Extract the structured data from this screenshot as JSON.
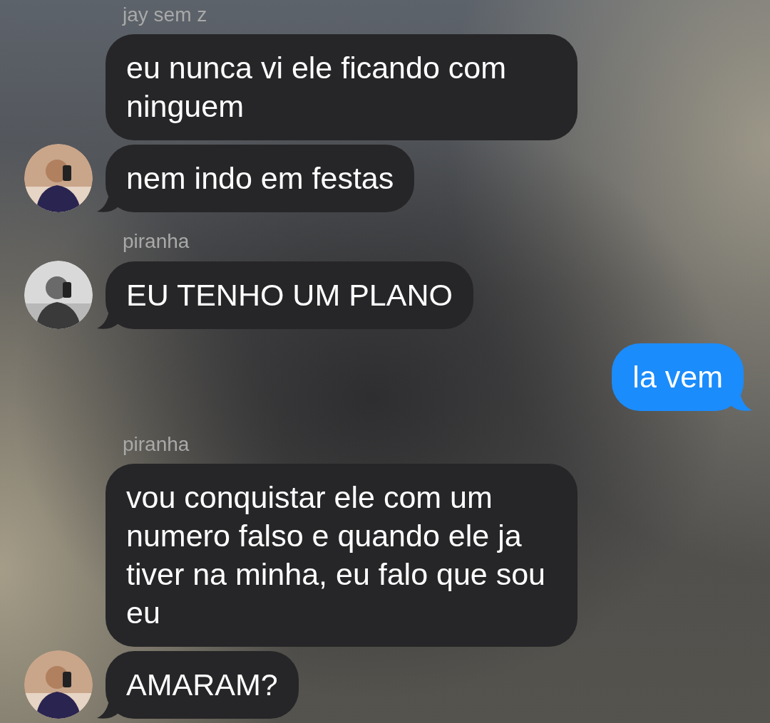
{
  "groups": [
    {
      "kind": "incoming",
      "sender": "jay sem z",
      "avatar": {
        "kind": "picture"
      },
      "messages": [
        "eu nunca vi ele ficando com ninguem",
        "nem indo em festas"
      ]
    },
    {
      "kind": "incoming",
      "sender": "piranha",
      "avatar": {
        "kind": "picture"
      },
      "messages": [
        "EU TENHO UM PLANO"
      ]
    },
    {
      "kind": "outgoing",
      "messages": [
        "la vem"
      ]
    },
    {
      "kind": "incoming",
      "sender": "piranha",
      "avatar": {
        "kind": "picture"
      },
      "messages": [
        "vou conquistar ele com um numero falso e quando ele ja tiver na minha, eu falo que sou eu",
        "AMARAM?"
      ]
    }
  ]
}
